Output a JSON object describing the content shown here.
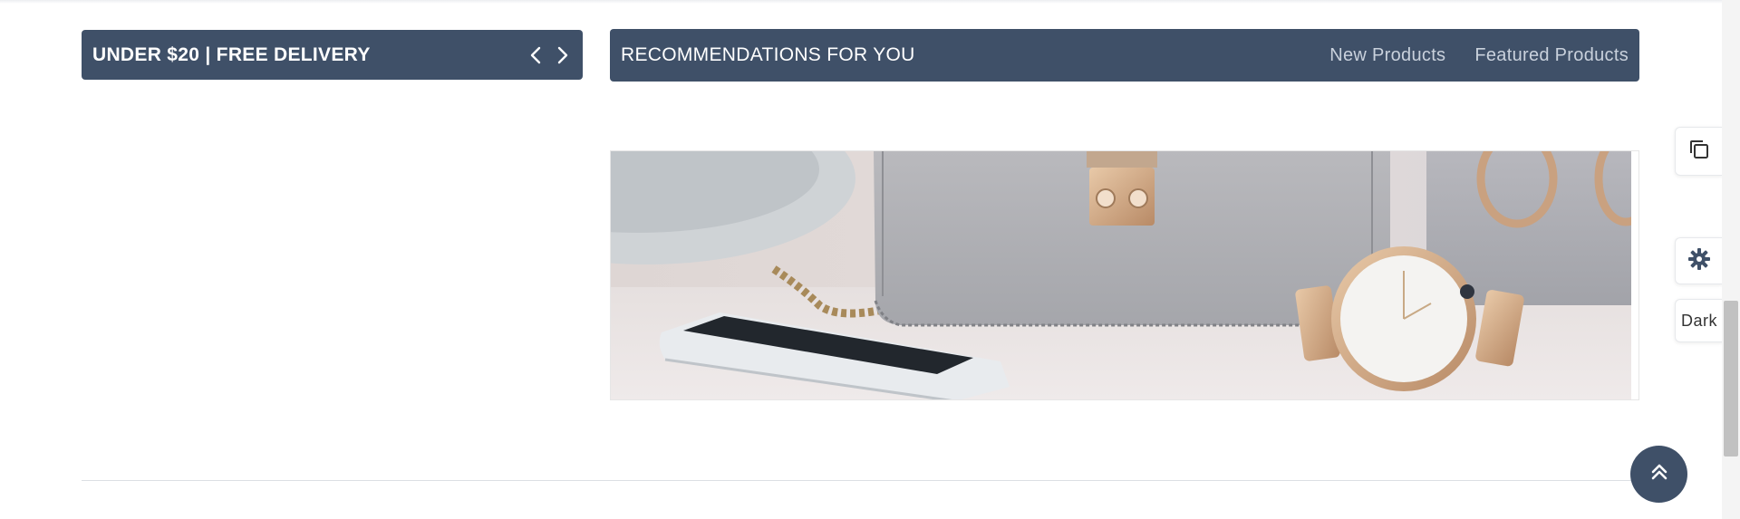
{
  "deals": {
    "title": "UNDER $20 | FREE DELIVERY",
    "prev_icon": "chevron-left-icon",
    "next_icon": "chevron-right-icon"
  },
  "recommendations": {
    "title": "RECOMMENDATIONS FOR YOU",
    "tabs": [
      {
        "label": "New Products"
      },
      {
        "label": "Featured Products"
      }
    ]
  },
  "side_tools": {
    "copy_icon": "copy-icon",
    "settings_icon": "gear-icon",
    "dark_label": "Dark"
  },
  "back_to_top_icon": "double-chevron-up-icon",
  "colors": {
    "header_bg": "#3f5068",
    "tab_text": "#c9d1dc",
    "accent_white": "#ffffff"
  }
}
